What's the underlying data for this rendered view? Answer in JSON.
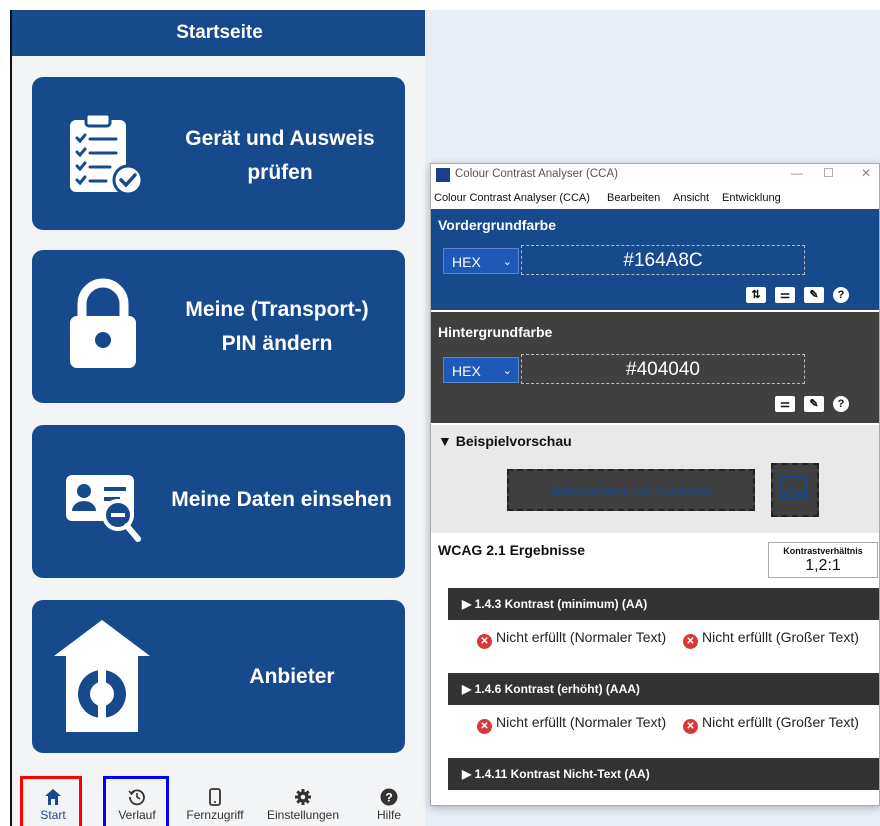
{
  "app": {
    "header_title": "Startseite",
    "tiles": [
      {
        "label": "Gerät und Ausweis\nprüfen",
        "icon": "clipboard-check-icon"
      },
      {
        "label": "Meine (Transport-)\nPIN ändern",
        "icon": "lock-icon"
      },
      {
        "label": "Meine Daten einsehen",
        "icon": "id-card-search-icon"
      },
      {
        "label": "Anbieter",
        "icon": "provider-house-icon"
      }
    ],
    "nav": [
      {
        "label": "Start",
        "icon": "home-icon"
      },
      {
        "label": "Verlauf",
        "icon": "history-icon"
      },
      {
        "label": "Fernzugriff",
        "icon": "phone-icon"
      },
      {
        "label": "Einstellungen",
        "icon": "gear-icon"
      },
      {
        "label": "Hilfe",
        "icon": "help-icon"
      }
    ]
  },
  "cca": {
    "window_title": "Colour Contrast Analyser (CCA)",
    "menu": [
      "Colour Contrast Analyser (CCA)",
      "Bearbeiten",
      "Ansicht",
      "Entwicklung"
    ],
    "foreground": {
      "title": "Vordergrundfarbe",
      "format": "HEX",
      "value": "#164A8C"
    },
    "background": {
      "title": "Hintergrundfarbe",
      "format": "HEX",
      "value": "#404040"
    },
    "preview": {
      "title": "▼ Beispielvorschau",
      "sample_text": "Beispieltext mit Kontrast"
    },
    "results": {
      "title": "WCAG 2.1 Ergebnisse",
      "ratio_label": "Kontrastverhältnis",
      "ratio_value": "1,2:1",
      "criteria": [
        {
          "label": "▶  1.4.3 Kontrast (minimum) (AA)",
          "normal": "Nicht erfüllt (Normaler Text)",
          "large": "Nicht erfüllt (Großer Text)"
        },
        {
          "label": "▶  1.4.6 Kontrast (erhöht) (AAA)",
          "normal": "Nicht erfüllt (Normaler Text)",
          "large": "Nicht erfüllt (Großer Text)"
        },
        {
          "label": "▶  1.4.11 Kontrast Nicht-Text (AA)"
        }
      ]
    }
  },
  "colors": {
    "brand_blue": "#164A8C",
    "dark_gray": "#404040",
    "fail_red": "#d9383a"
  }
}
